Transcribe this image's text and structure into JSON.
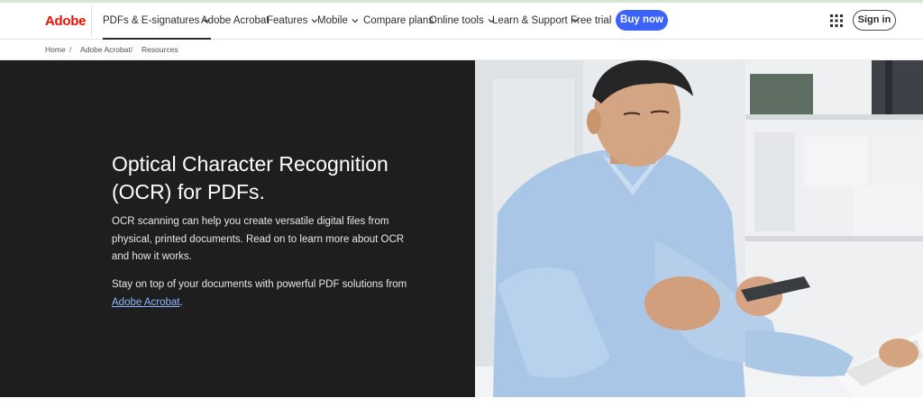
{
  "brand": {
    "logo": "Adobe",
    "accent": "#eb1000"
  },
  "nav": {
    "items": [
      {
        "label": "PDFs & E-signatures",
        "dropdown": true,
        "active": true
      },
      {
        "label": "Adobe Acrobat",
        "dropdown": false
      },
      {
        "label": "Features",
        "dropdown": true
      },
      {
        "label": "Mobile",
        "dropdown": true
      },
      {
        "label": "Compare plans",
        "dropdown": false
      },
      {
        "label": "Online tools",
        "dropdown": true
      },
      {
        "label": "Learn & Support",
        "dropdown": true
      },
      {
        "label": "Free trial",
        "dropdown": false
      }
    ],
    "buy_label": "Buy now",
    "buy_color": "#3b63fb",
    "apps_icon": "apps-grid-icon",
    "signin_label": "Sign in"
  },
  "breadcrumb": {
    "items": [
      "Home",
      "Adobe Acrobat",
      "Resources"
    ],
    "separator": "/"
  },
  "hero": {
    "title_line1": "Optical Character Recognition",
    "title_line2": "(OCR) for PDFs.",
    "description": "OCR scanning can help you create versatile digital files from physical, printed documents. Read on to learn more about OCR and how it works.",
    "cta_text": "Stay on top of your documents with powerful PDF solutions from ",
    "cta_link": "Adobe Acrobat",
    "cta_suffix": ".",
    "panel_color": "#1e1e1e",
    "image_subject": "man-reading-phone-at-desk"
  }
}
